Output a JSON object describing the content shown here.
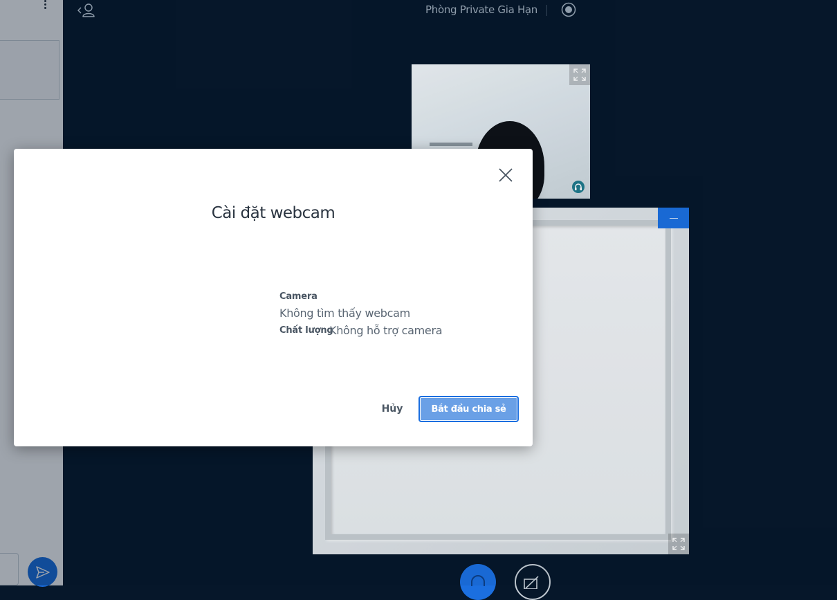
{
  "header": {
    "room_title": "Phòng Private Gia Hạn"
  },
  "icons": {
    "user_list": "user-list-toggle-icon",
    "record": "record-icon",
    "fullscreen": "fullscreen-icon",
    "headset": "headset-icon",
    "minimize": "minimize-icon",
    "send": "send-icon",
    "close": "close-icon",
    "audio": "headset-icon",
    "video_off": "video-off-icon"
  },
  "modal": {
    "title": "Cài đặt webcam",
    "camera_label": "Camera",
    "camera_value": "Không tìm thấy webcam",
    "quality_label": "Chất lượng",
    "quality_value": "Không hỗ trợ camera",
    "cancel_label": "Hủy",
    "start_label": "Bắt đầu chia sẻ"
  },
  "colors": {
    "background": "#06172a",
    "accent": "#1b6fe0",
    "primary_button": "#6aa0e6"
  }
}
